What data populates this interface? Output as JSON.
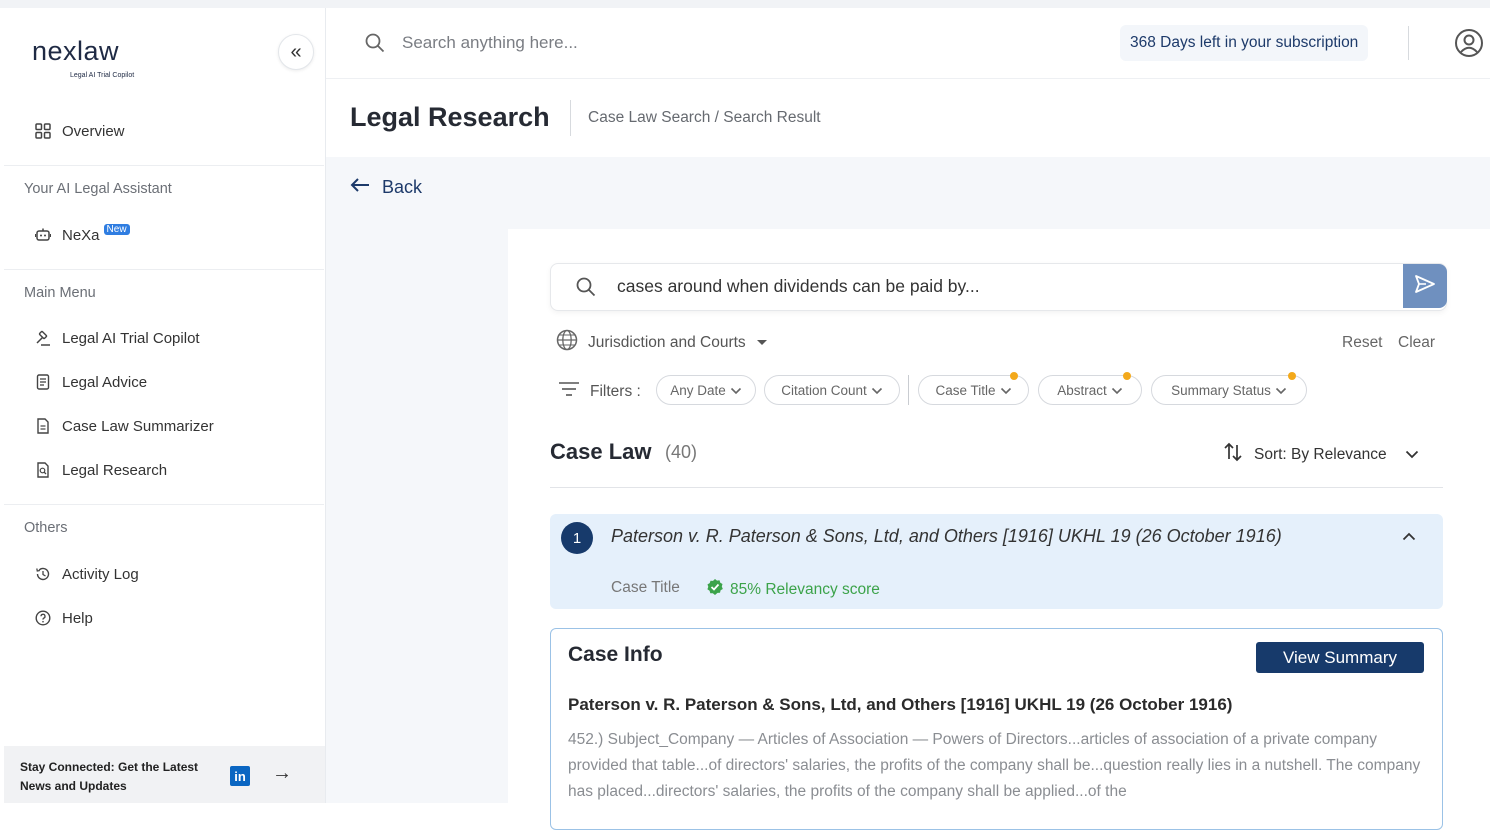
{
  "brand": {
    "name": "nexlaw",
    "tagline": "Legal AI Trial Copilot"
  },
  "sidebar": {
    "collapse_icon": "double-chevron-left-icon",
    "overview": "Overview",
    "assistant_section": "Your AI Legal Assistant",
    "nexa": {
      "label": "NeXa",
      "badge": "New"
    },
    "main_section": "Main Menu",
    "main_items": [
      {
        "label": "Legal AI Trial Copilot",
        "icon": "gavel-icon"
      },
      {
        "label": "Legal Advice",
        "icon": "document-list-icon"
      },
      {
        "label": "Case Law Summarizer",
        "icon": "document-icon"
      },
      {
        "label": "Legal Research",
        "icon": "document-search-icon"
      }
    ],
    "others_section": "Others",
    "other_items": [
      {
        "label": "Activity Log",
        "icon": "history-icon"
      },
      {
        "label": "Help",
        "icon": "help-icon"
      }
    ],
    "footer": {
      "text": "Stay Connected: Get the Latest News and Updates",
      "linkedin": "in"
    }
  },
  "header": {
    "search_placeholder": "Search anything here...",
    "subscription": "368 Days left in your subscription"
  },
  "page": {
    "title": "Legal Research",
    "breadcrumb": "Case Law Search / Search Result",
    "back": "Back"
  },
  "search": {
    "query": "cases around when dividends can be paid by...",
    "jurisdiction": "Jurisdiction and Courts",
    "reset": "Reset",
    "clear": "Clear",
    "filters_label": "Filters :",
    "filters": [
      {
        "label": "Any Date",
        "active": false
      },
      {
        "label": "Citation Count",
        "active": false
      },
      {
        "label": "Case Title",
        "active": true
      },
      {
        "label": "Abstract",
        "active": true
      },
      {
        "label": "Summary Status",
        "active": true
      }
    ]
  },
  "results": {
    "heading": "Case Law",
    "count": "(40)",
    "sort": "Sort: By Relevance",
    "items": [
      {
        "index": "1",
        "title": "Paterson v. R. Paterson & Sons, Ltd, and Others [1916] UKHL 19 (26 October 1916)",
        "meta_label": "Case Title",
        "relevancy": "85% Relevancy score"
      }
    ]
  },
  "case_info": {
    "heading": "Case Info",
    "view_summary": "View Summary",
    "case_name": "Paterson v. R. Paterson & Sons, Ltd, and Others [1916] UKHL 19 (26 October 1916)",
    "excerpt": "452.) Subject_Company — Articles of Association — Powers of Directors...articles of association of a private company provided that table...of directors' salaries, the profits of the company shall be...question really lies in a nutshell. The company has placed...directors' salaries, the profits of the company shall be applied...of the"
  },
  "colors": {
    "navy": "#173a6b",
    "accent_dot": "#f3a91b",
    "relevancy_green": "#3ca34a",
    "result_bg": "#e5f0fb"
  }
}
